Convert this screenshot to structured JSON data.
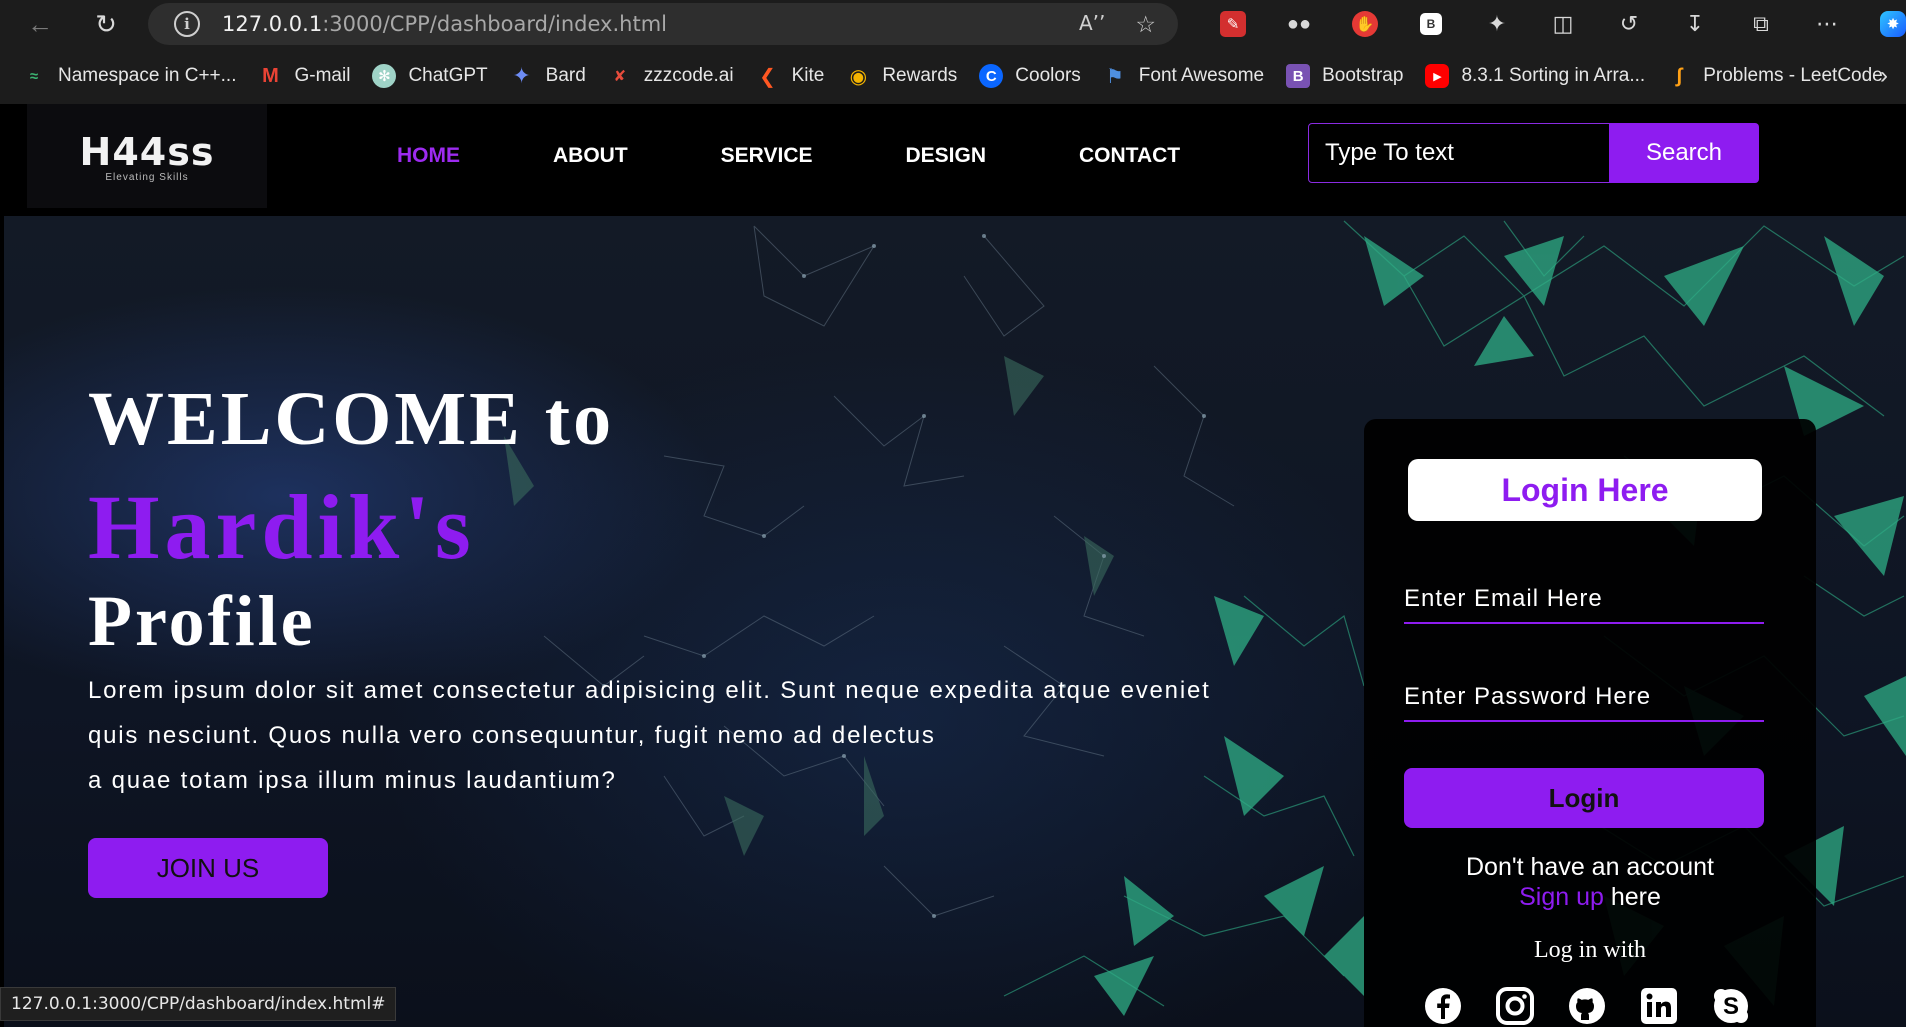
{
  "browser": {
    "url_host": "127.0.0.1",
    "url_rest": ":3000/CPP/dashboard/index.html",
    "bookmarks": [
      {
        "label": "Namespace in C++...",
        "icon": "namespace-icon",
        "color": "#3cb371"
      },
      {
        "label": "G-mail",
        "icon": "gmail-icon",
        "color": "#ea4335"
      },
      {
        "label": "ChatGPT",
        "icon": "chatgpt-icon",
        "color": "#9fd3c7"
      },
      {
        "label": "Bard",
        "icon": "bard-icon",
        "color": "#6d8cf5"
      },
      {
        "label": "zzzcode.ai",
        "icon": "zzzcode-icon",
        "color": "#e74c3c"
      },
      {
        "label": "Kite",
        "icon": "kite-icon",
        "color": "#ff5722"
      },
      {
        "label": "Rewards",
        "icon": "rewards-icon",
        "color": "#f4b400"
      },
      {
        "label": "Coolors",
        "icon": "coolors-icon",
        "color": "#0a66ff"
      },
      {
        "label": "Font Awesome",
        "icon": "font-awesome-icon",
        "color": "#4e8fe0"
      },
      {
        "label": "Bootstrap",
        "icon": "bootstrap-icon",
        "color": "#7952b3"
      },
      {
        "label": "8.3.1 Sorting in Arra...",
        "icon": "youtube-icon",
        "color": "#ff0000"
      },
      {
        "label": "Problems - LeetCode",
        "icon": "leetcode-icon",
        "color": "#ffa116"
      }
    ],
    "status_url": "127.0.0.1:3000/CPP/dashboard/index.html#"
  },
  "site": {
    "logo": {
      "main": "H44ss",
      "sub": "Elevating Skills"
    },
    "menu": [
      "HOME",
      "ABOUT",
      "SERVICE",
      "DESIGN",
      "CONTACT"
    ],
    "active_menu": "HOME",
    "search_placeholder": "Type To text",
    "search_button": "Search"
  },
  "hero": {
    "welcome": "WELCOME to",
    "name": "Hardik's",
    "profile": "Profile",
    "description_lines": [
      "Lorem ipsum dolor sit amet consectetur adipisicing elit. Sunt neque expedita atque eveniet",
      "quis nesciunt. Quos nulla vero consequuntur, fugit nemo ad delectus",
      "a quae totam ipsa illum minus laudantium?"
    ],
    "join_button": "JOIN US"
  },
  "login": {
    "title": "Login Here",
    "email_placeholder": "Enter Email Here",
    "password_placeholder": "Enter Password Here",
    "login_button": "Login",
    "no_account": "Don't have an account",
    "signup_link": "Sign up",
    "signup_suffix": " here",
    "login_with": "Log in with",
    "socials": [
      "facebook-icon",
      "instagram-icon",
      "github-icon",
      "linkedin-icon",
      "skype-icon"
    ]
  },
  "colors": {
    "accent": "#8e1cf0",
    "active_menu": "#9d2bf0",
    "network": "#2fae86"
  }
}
